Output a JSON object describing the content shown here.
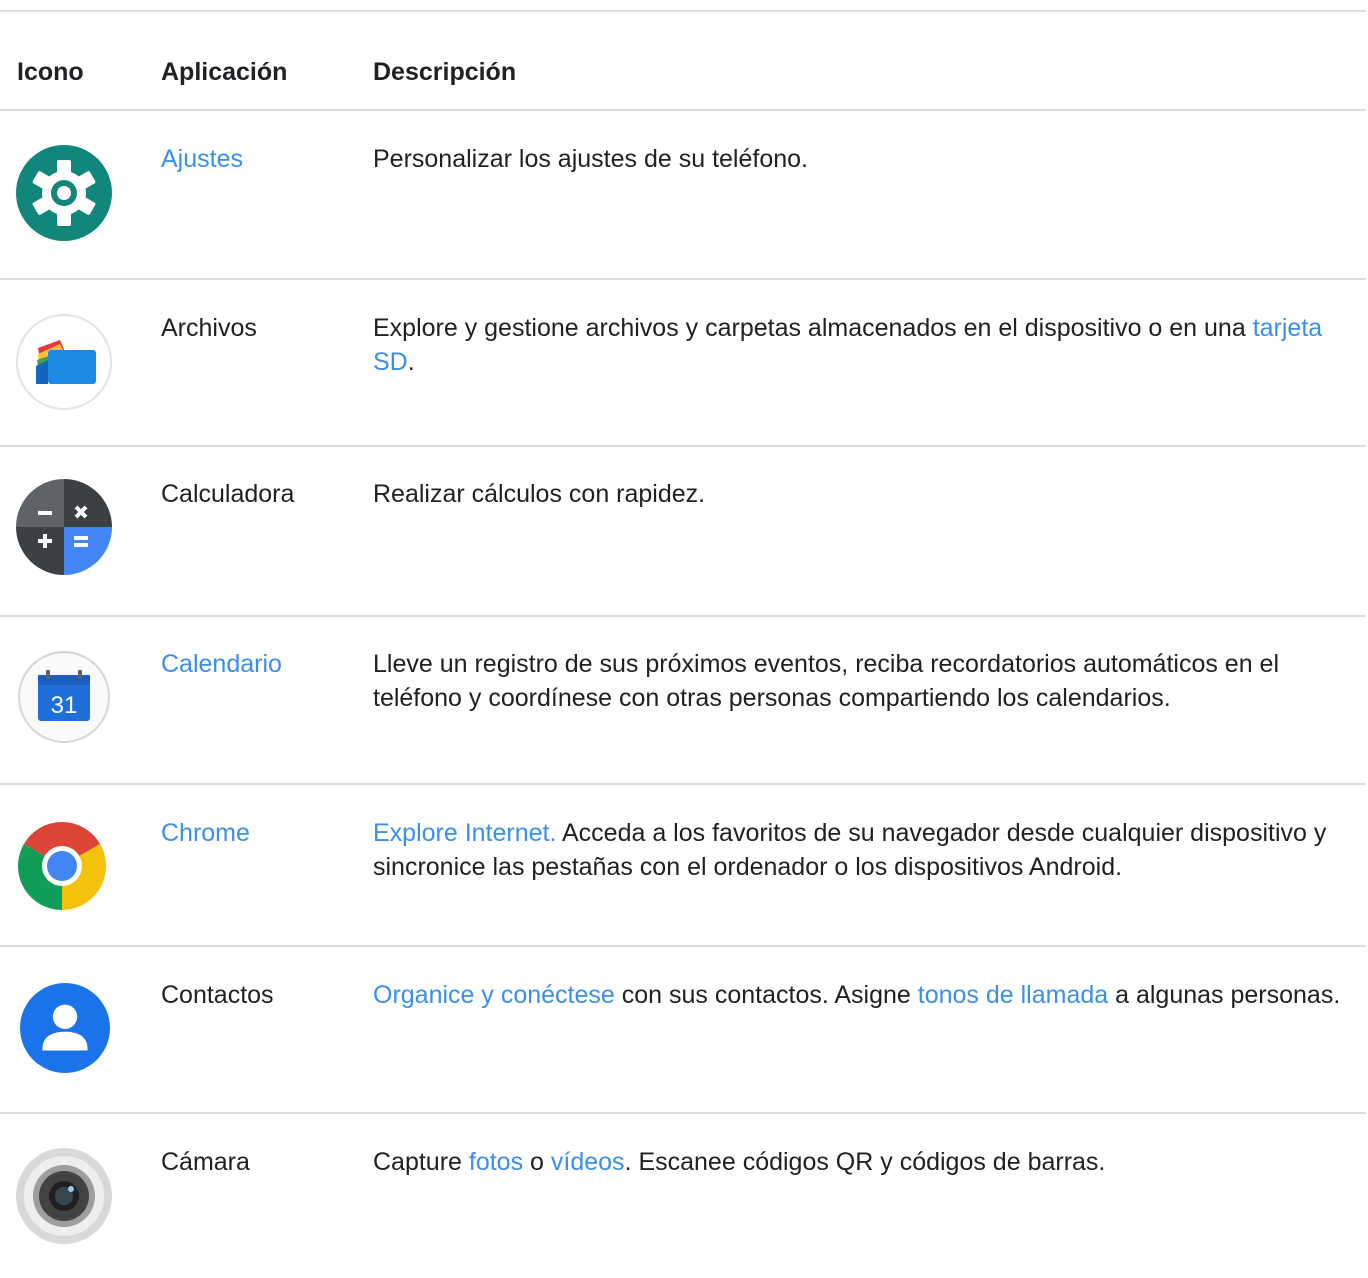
{
  "headers": {
    "icon": "Icono",
    "app": "Aplicación",
    "description": "Descripción"
  },
  "rows": [
    {
      "icon": "settings-gear-icon",
      "app": "Ajustes",
      "app_is_link": true,
      "description": [
        {
          "text": "Personalizar los ajustes de su teléfono.",
          "link": false
        }
      ]
    },
    {
      "icon": "files-icon",
      "app": "Archivos",
      "app_is_link": false,
      "description": [
        {
          "text": "Explore y gestione archivos y carpetas almacenados en el dispositivo o en una ",
          "link": false
        },
        {
          "text": "tarjeta SD",
          "link": true
        },
        {
          "text": ".",
          "link": false
        }
      ]
    },
    {
      "icon": "calculator-icon",
      "app": "Calculadora",
      "app_is_link": false,
      "description": [
        {
          "text": "Realizar cálculos con rapidez.",
          "link": false
        }
      ]
    },
    {
      "icon": "calendar-icon",
      "icon_text": "31",
      "app": "Calendario",
      "app_is_link": true,
      "description": [
        {
          "text": "Lleve un registro de sus próximos eventos, reciba recordatorios automáticos en el teléfono y coordínese con otras personas compartiendo los calendarios.",
          "link": false
        }
      ]
    },
    {
      "icon": "chrome-icon",
      "app": "Chrome",
      "app_is_link": true,
      "description": [
        {
          "text": "Explore Internet.",
          "link": true
        },
        {
          "text": " Acceda a los favoritos de su navegador desde cualquier dispositivo y sincronice las pestañas con el ordenador o los dispositivos Android.",
          "link": false
        }
      ]
    },
    {
      "icon": "contacts-icon",
      "app": "Contactos",
      "app_is_link": false,
      "description": [
        {
          "text": "Organice y conéctese",
          "link": true
        },
        {
          "text": " con sus contactos. Asigne ",
          "link": false
        },
        {
          "text": "tonos de llamada",
          "link": true
        },
        {
          "text": " a algunas personas.",
          "link": false
        }
      ]
    },
    {
      "icon": "camera-icon",
      "app": "Cámara",
      "app_is_link": false,
      "description": [
        {
          "text": "Capture ",
          "link": false
        },
        {
          "text": "fotos",
          "link": true
        },
        {
          "text": " o ",
          "link": false
        },
        {
          "text": "vídeos",
          "link": true
        },
        {
          "text": ". Escanee códigos QR y códigos de barras.",
          "link": false
        }
      ]
    }
  ],
  "colors": {
    "link": "#3a8fe8",
    "text": "#202124",
    "rule": "#dadce0"
  }
}
